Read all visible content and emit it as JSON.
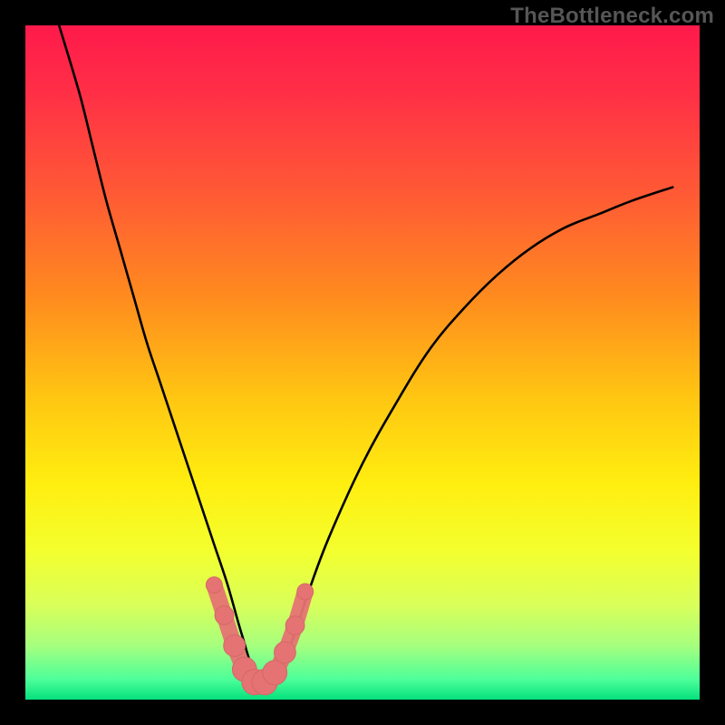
{
  "watermark": "TheBottleneck.com",
  "colors": {
    "frame": "#000000",
    "curve": "#000000",
    "marker_fill": "#e57373",
    "marker_stroke": "#d46868",
    "gradient_stops": [
      {
        "offset": 0.0,
        "color": "#ff1a4b"
      },
      {
        "offset": 0.1,
        "color": "#ff2f46"
      },
      {
        "offset": 0.25,
        "color": "#ff5a35"
      },
      {
        "offset": 0.4,
        "color": "#ff8a1f"
      },
      {
        "offset": 0.55,
        "color": "#ffc512"
      },
      {
        "offset": 0.68,
        "color": "#ffee10"
      },
      {
        "offset": 0.78,
        "color": "#f3ff2e"
      },
      {
        "offset": 0.86,
        "color": "#d9ff5a"
      },
      {
        "offset": 0.92,
        "color": "#a6ff7e"
      },
      {
        "offset": 0.97,
        "color": "#4dff9a"
      },
      {
        "offset": 1.0,
        "color": "#05e07d"
      }
    ]
  },
  "chart_data": {
    "type": "line",
    "title": "",
    "xlabel": "",
    "ylabel": "",
    "xlim": [
      0,
      100
    ],
    "ylim": [
      0,
      100
    ],
    "grid": false,
    "legend": false,
    "notes": "Bottleneck-style chart: vertical gradient from red (top, high bottleneck) to green (bottom, low bottleneck). Black V-shaped curve reaches minimum near x≈33. Salmon markers highlight the near-minimum region along the curve.",
    "series": [
      {
        "name": "curve",
        "x": [
          5,
          8,
          10,
          12,
          14,
          16,
          18,
          20,
          22,
          24,
          26,
          28,
          30,
          32,
          34,
          36,
          38,
          40,
          42,
          45,
          50,
          55,
          60,
          65,
          70,
          75,
          80,
          85,
          90,
          96
        ],
        "y": [
          100,
          90,
          82,
          74,
          67,
          60,
          53,
          47,
          41,
          35,
          29,
          23,
          17,
          10,
          4,
          3,
          5,
          10,
          16,
          24,
          35,
          44,
          52,
          58,
          63,
          67,
          70,
          72,
          74,
          76
        ]
      }
    ],
    "markers": {
      "name": "highlight",
      "points": [
        {
          "x": 28.0,
          "y": 17.0,
          "r": 1.2
        },
        {
          "x": 29.5,
          "y": 12.5,
          "r": 1.4
        },
        {
          "x": 31.0,
          "y": 8.0,
          "r": 1.6
        },
        {
          "x": 32.5,
          "y": 4.5,
          "r": 1.8
        },
        {
          "x": 34.0,
          "y": 2.6,
          "r": 1.9
        },
        {
          "x": 35.5,
          "y": 2.6,
          "r": 1.9
        },
        {
          "x": 37.0,
          "y": 4.0,
          "r": 1.8
        },
        {
          "x": 38.5,
          "y": 7.0,
          "r": 1.6
        },
        {
          "x": 40.0,
          "y": 11.0,
          "r": 1.4
        },
        {
          "x": 41.5,
          "y": 16.0,
          "r": 1.2
        }
      ]
    }
  }
}
